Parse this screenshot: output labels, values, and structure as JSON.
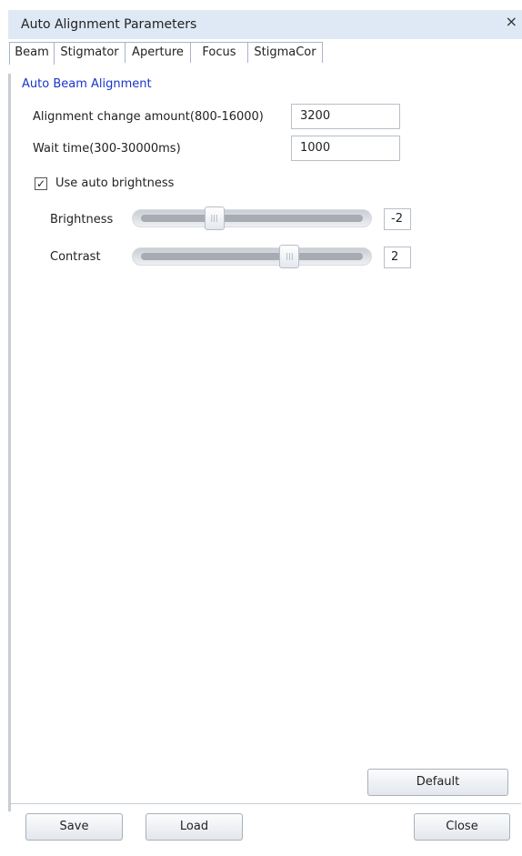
{
  "window": {
    "title": "Auto Alignment Parameters",
    "close_glyph": "×"
  },
  "tabs": [
    {
      "label": "Beam",
      "active": true
    },
    {
      "label": "Stigmator",
      "active": false
    },
    {
      "label": "Aperture",
      "active": false
    },
    {
      "label": "Focus",
      "active": false
    },
    {
      "label": "StigmaCor",
      "active": false
    }
  ],
  "beam": {
    "section_title": "Auto Beam Alignment",
    "alignment_label": "Alignment change amount(800-16000)",
    "alignment_value": "3200",
    "wait_label": "Wait time(300-30000ms)",
    "wait_value": "1000",
    "auto_brightness_label": "Use auto brightness",
    "auto_brightness_checked": true,
    "check_glyph": "✓",
    "brightness_label": "Brightness",
    "brightness_value": "-2",
    "brightness_level": 0.33,
    "contrast_label": "Contrast",
    "contrast_value": "2",
    "contrast_level": 0.67,
    "thumb_grip": "|||"
  },
  "buttons": {
    "default": "Default",
    "save": "Save",
    "load": "Load",
    "close": "Close"
  },
  "colors": {
    "title_bar": "#dfe9f5",
    "section_title": "#1a35c9"
  }
}
